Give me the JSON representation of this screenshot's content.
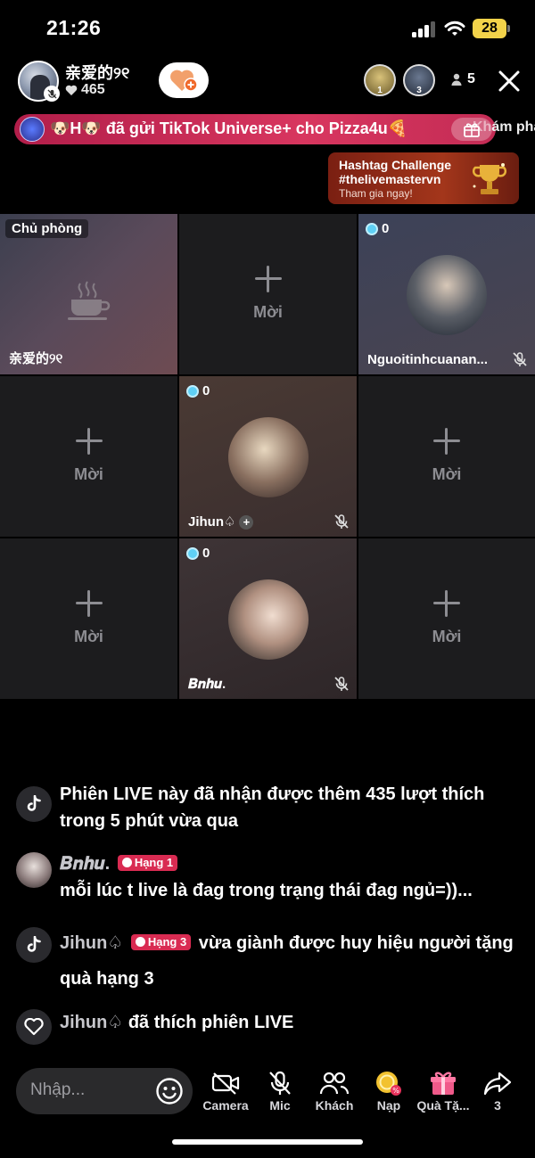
{
  "status": {
    "time": "21:26",
    "battery": "28"
  },
  "host": {
    "name": "亲爱的୨୧",
    "likes": "465"
  },
  "viewers": {
    "ranks": [
      "1",
      "3"
    ],
    "count": "5"
  },
  "banner": {
    "text": "🐶H🐶 đã gửi TikTok Universe+ cho Pizza4u🍕",
    "explore_lead": "Kh",
    "explore": "ám phá"
  },
  "hashtag": {
    "title": "Hashtag Challenge",
    "tag": "#thelivemastervn",
    "cta": "Tham gia ngay!"
  },
  "grid": {
    "host_tag": "Chủ phòng",
    "host_name": "亲爱的୨୧",
    "invite_label": "Mời",
    "guests": [
      {
        "name": "Nguoitinhcuanan...",
        "score": "0"
      },
      {
        "name": "Jihun♤",
        "score": "0"
      },
      {
        "name": "𝑩𝒏𝒉𝒖.",
        "score": "0"
      }
    ]
  },
  "chat": {
    "messages": [
      {
        "type": "system",
        "icon": "tiktok-icon",
        "text": "Phiên LIVE này đã nhận được thêm 435 lượt thích trong 5 phút vừa qua"
      },
      {
        "type": "comment",
        "user": "𝑩𝒏𝒉𝒖.",
        "badge": "Hạng 1",
        "text": "mỗi lúc t live là đag trong trạng thái đag ngủ=))..."
      },
      {
        "type": "system",
        "icon": "tiktok-icon",
        "user": "Jihun♤",
        "badge": "Hạng 3",
        "text": "vừa giành được huy hiệu người tặng quà hạng 3"
      },
      {
        "type": "like",
        "icon": "heart-icon",
        "user": "Jihun♤",
        "text": "đã thích phiên LIVE"
      }
    ]
  },
  "bottom": {
    "placeholder": "Nhập...",
    "tools": [
      "Camera",
      "Mic",
      "Khách",
      "Nạp",
      "Quà Tặ...",
      "3"
    ]
  },
  "colors": {
    "accent": "#d92b52",
    "score": "#5fd0f5",
    "banner": "#c42c55"
  }
}
